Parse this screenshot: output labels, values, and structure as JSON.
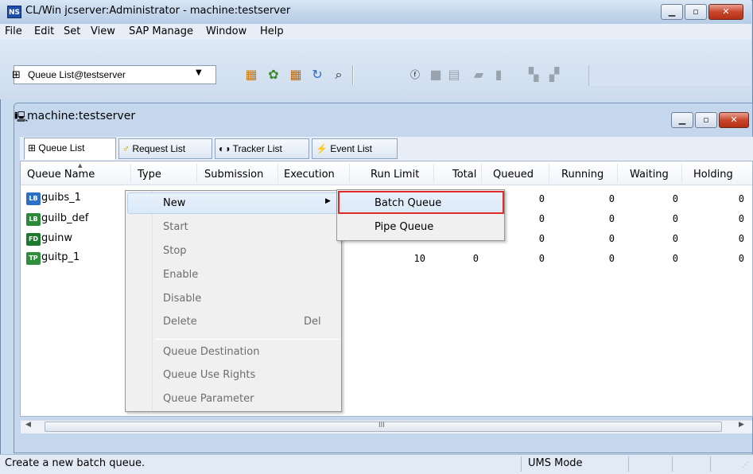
{
  "window": {
    "app_icon": "NS",
    "title": "CL/Win jcserver:Administrator - machine:testserver"
  },
  "menubar": [
    "File",
    "Edit",
    "Set",
    "View",
    "SAP Manage",
    "Window",
    "Help"
  ],
  "toolbar": {
    "combo_value": "Queue List@testserver",
    "icons": [
      "queue-icon",
      "request-icon",
      "tracker-icon",
      "refresh-icon",
      "find-icon",
      "help-icon",
      "job-icon",
      "job-icon",
      "job-icon",
      "job-icon",
      "job-icon"
    ]
  },
  "inner_window": {
    "title": "machine:testserver",
    "tabs": [
      "Queue List",
      "Request List",
      "Tracker List",
      "Event List"
    ]
  },
  "table": {
    "columns": [
      "Queue Name",
      "Type",
      "Submission",
      "Execution",
      "Run Limit",
      "Total",
      "Queued",
      "Running",
      "Waiting",
      "Holding"
    ],
    "rows": [
      {
        "name": "guibs_1",
        "icon": "LB",
        "icon_color": "#2b6fc9",
        "run_limit": "",
        "total": "",
        "queued": "0",
        "running": "0",
        "waiting": "0",
        "holding": "0"
      },
      {
        "name": "guilb_def",
        "icon": "LB",
        "icon_color": "#2b8a3a",
        "run_limit": "",
        "total": "",
        "queued": "0",
        "running": "0",
        "waiting": "0",
        "holding": "0"
      },
      {
        "name": "guinw",
        "icon": "FD",
        "icon_color": "#1c7a2c",
        "run_limit": "",
        "total": "",
        "queued": "0",
        "running": "0",
        "waiting": "0",
        "holding": "0"
      },
      {
        "name": "guitp_1",
        "icon": "TP",
        "icon_color": "#2e8f3c",
        "run_limit": "10",
        "total": "0",
        "queued": "0",
        "running": "0",
        "waiting": "0",
        "holding": "0"
      }
    ]
  },
  "context_menu": {
    "items": [
      {
        "label": "New",
        "enabled": true
      },
      {
        "label": "Start",
        "enabled": false
      },
      {
        "label": "Stop",
        "enabled": false
      },
      {
        "label": "Enable",
        "enabled": false
      },
      {
        "label": "Disable",
        "enabled": false
      },
      {
        "label": "Delete",
        "enabled": false,
        "shortcut": "Del"
      },
      {
        "label": "Queue Destination",
        "enabled": false
      },
      {
        "label": "Queue Use Rights",
        "enabled": false
      },
      {
        "label": "Queue Parameter",
        "enabled": false
      }
    ],
    "submenu": [
      "Batch Queue",
      "Pipe Queue"
    ],
    "highlight_color": "#e02a2a"
  },
  "hscroll_mark": "III",
  "statusbar": {
    "message": "Create a new batch queue.",
    "mode": "UMS Mode"
  }
}
